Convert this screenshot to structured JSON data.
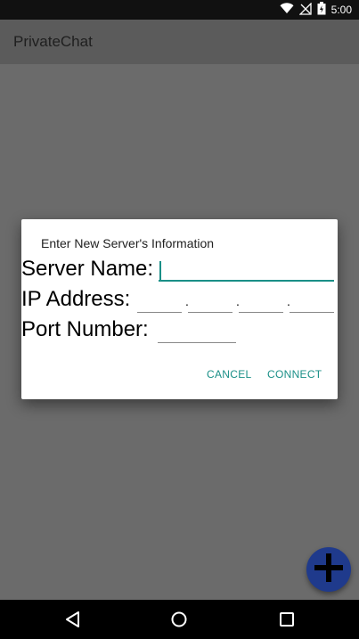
{
  "status_bar": {
    "time": "5:00",
    "icons": [
      "wifi-icon",
      "no-signal-icon",
      "battery-icon"
    ]
  },
  "app_bar": {
    "title": "PrivateChat"
  },
  "dialog": {
    "title": "Enter New Server's Information",
    "server_name_label": "Server Name:",
    "server_name_value": "",
    "ip_label": "IP Address:",
    "ip_octets": [
      "",
      "",
      "",
      ""
    ],
    "ip_separator": ".",
    "port_label": "Port Number:",
    "port_value": "",
    "cancel_label": "CANCEL",
    "connect_label": "CONNECT"
  },
  "fab": {
    "icon": "plus-icon"
  },
  "nav_bar": {
    "icons": [
      "back-icon",
      "home-icon",
      "recents-icon"
    ]
  },
  "colors": {
    "accent": "#1a8f87",
    "fab": "#1f3a8c",
    "scrim": "#6b6b6b",
    "status_bar": "#111111"
  }
}
